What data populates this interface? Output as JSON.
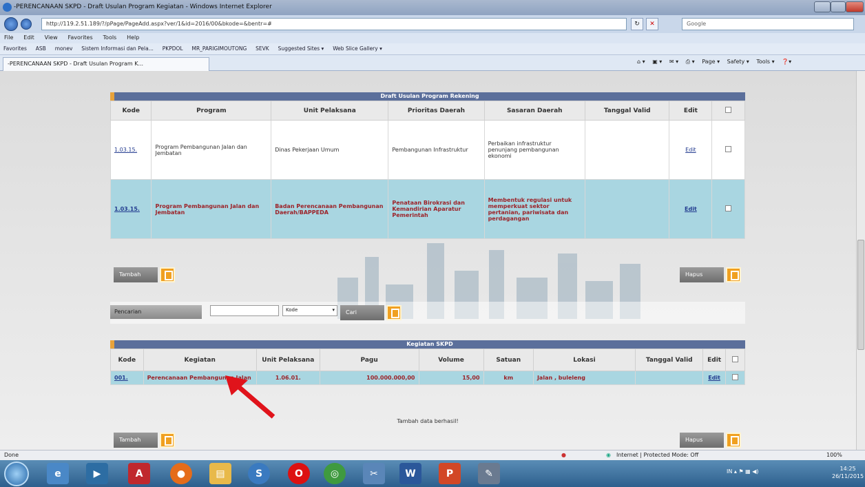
{
  "window": {
    "title": "-PERENCANAAN SKPD - Draft Usulan Program Kegiatan - Windows Internet Explorer",
    "url": "http://119.2.51.189/?/pPage/PageAdd.aspx?ver/1&id=2016/00&bkode=&bentr=#",
    "search_placeholder": "Google"
  },
  "menu": [
    "File",
    "Edit",
    "View",
    "Favorites",
    "Tools",
    "Help"
  ],
  "favorites": [
    "Favorites",
    "ASB",
    "monev",
    "Sistem Informasi dan Pela...",
    "PKPDOL",
    "MR_PARIGIMOUTONG",
    "SEVK",
    "Suggested Sites ▾",
    "Web Slice Gallery ▾"
  ],
  "tab": {
    "label": "-PERENCANAAN SKPD - Draft Usulan Program K..."
  },
  "cmdbar": [
    "Page ▾",
    "Safety ▾",
    "Tools ▾"
  ],
  "program_panel": {
    "title": "Draft Usulan Program Rekening",
    "headers": [
      "Kode",
      "Program",
      "Unit Pelaksana",
      "Prioritas Daerah",
      "Sasaran Daerah",
      "Tanggal Valid",
      "Edit",
      ""
    ],
    "rows": [
      {
        "kode": "1.03.15.",
        "program": "Program Pembangunan Jalan dan Jembatan",
        "unit": "Dinas Pekerjaan Umum",
        "prioritas": "Pembangunan Infrastruktur",
        "sasaran": "Perbaikan infrastruktur penunjang pembangunan ekonomi",
        "tanggal": "",
        "edit": "Edit"
      },
      {
        "kode": "1.03.15.",
        "program": "Program Pembangunan Jalan dan Jembatan",
        "unit": "Badan Perencanaan Pembangunan Daerah/BAPPEDA",
        "prioritas": "Penataan Birokrasi dan Kemandirian Aparatur Pemerintah",
        "sasaran": "Membentuk regulasi untuk memperkuat sektor pertanian, pariwisata dan perdagangan",
        "tanggal": "",
        "edit": "Edit"
      }
    ],
    "tambah": "Tambah",
    "hapus": "Hapus"
  },
  "search": {
    "label": "Pencarian",
    "input": "",
    "select": "Kode",
    "cari": "Cari"
  },
  "kegiatan_panel": {
    "title": "Kegiatan SKPD",
    "headers": [
      "Kode",
      "Kegiatan",
      "Unit Pelaksana",
      "Pagu",
      "Volume",
      "Satuan",
      "Lokasi",
      "Tanggal Valid",
      "Edit",
      ""
    ],
    "rows": [
      {
        "kode": "001.",
        "kegiatan": "Perencanaan Pembangunan Jalan",
        "unit": "1.06.01.",
        "pagu": "100.000.000,00",
        "volume": "15,00",
        "satuan": "km",
        "lokasi": "Jalan , buleleng",
        "tanggal": "",
        "edit": "Edit"
      }
    ],
    "message": "Tambah data berhasil!",
    "tambah": "Tambah",
    "hapus": "Hapus"
  },
  "status": {
    "left": "Done",
    "zone": "Internet | Protected Mode: Off",
    "zoom": "100%"
  },
  "taskbar": {
    "clock_time": "14:25",
    "clock_date": "26/11/2015",
    "lang": "IN"
  }
}
